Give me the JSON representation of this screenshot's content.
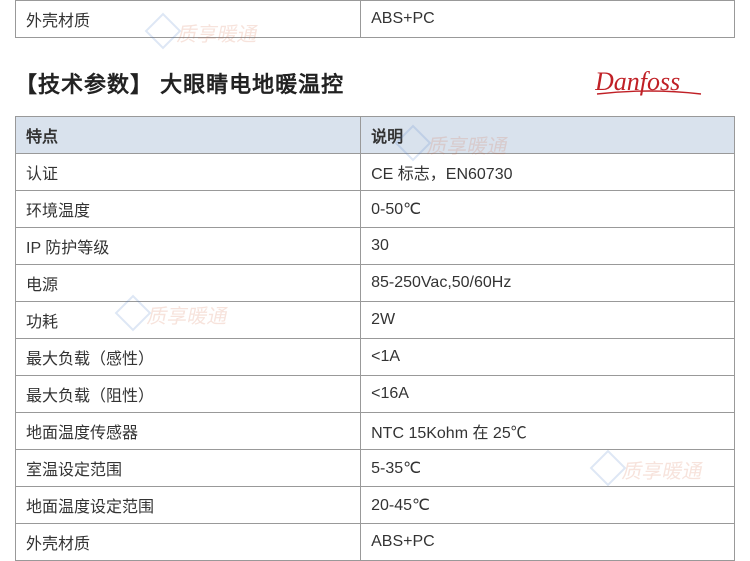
{
  "top_row": {
    "label": "外壳材质",
    "value": "ABS+PC"
  },
  "section_title": "【技术参数】 大眼睛电地暖温控",
  "brand_name": "Danfoss",
  "table": {
    "header": {
      "col1": "特点",
      "col2": "说明"
    },
    "rows": [
      {
        "label": "认证",
        "value": "CE 标志，EN60730"
      },
      {
        "label": "环境温度",
        "value": "0-50℃"
      },
      {
        "label": "IP 防护等级",
        "value": "30"
      },
      {
        "label": "电源",
        "value": "85-250Vac,50/60Hz"
      },
      {
        "label": "功耗",
        "value": "2W"
      },
      {
        "label": "最大负载（感性）",
        "value": "<1A"
      },
      {
        "label": "最大负载（阻性）",
        "value": "<16A"
      },
      {
        "label": "地面温度传感器",
        "value": "NTC 15Kohm  在 25℃"
      },
      {
        "label": "室温设定范围",
        "value": "5-35℃"
      },
      {
        "label": "地面温度设定范围",
        "value": "20-45℃"
      },
      {
        "label": "外壳材质",
        "value": "ABS+PC"
      }
    ]
  },
  "watermark_text": "质享暖通",
  "brand_color": "#c02026"
}
